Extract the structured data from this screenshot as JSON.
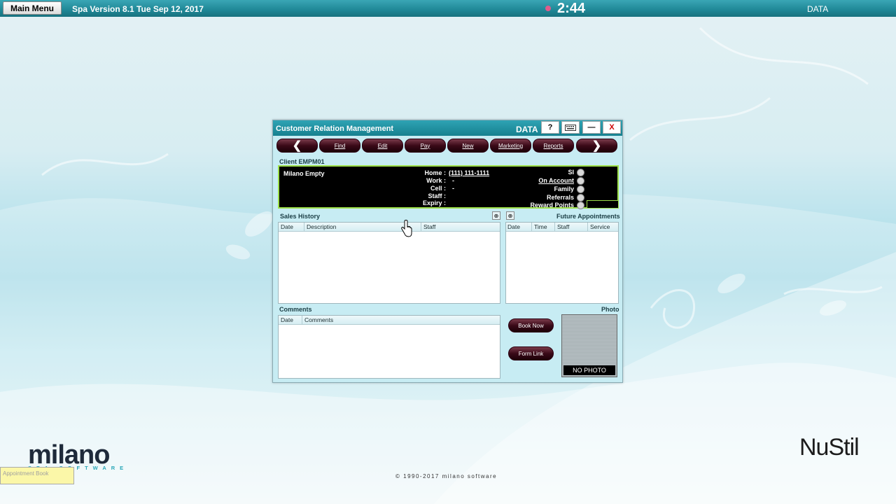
{
  "topbar": {
    "main_menu": "Main Menu",
    "version": "Spa Version 8.1   Tue Sep 12, 2017",
    "clock": "2:44",
    "data_label": "DATA"
  },
  "window": {
    "title": "Customer Relation Management",
    "data_label": "DATA",
    "help": "?",
    "minimize": "—",
    "close": "X",
    "toolbar": {
      "prev": "❮",
      "find": "Find",
      "edit": "Edit",
      "pay": "Pay",
      "new": "New",
      "marketing": "Marketing",
      "reports": "Reports",
      "next": "❯"
    },
    "client": {
      "label": "Client EMPM01",
      "name": "Milano Empty",
      "home_label": "Home :",
      "home_value": "(111) 111-1111",
      "work_label": "Work :",
      "work_value": "-",
      "cell_label": "Cell :",
      "cell_value": "-",
      "staff_label": "Staff :",
      "expiry_label": "Expiry :",
      "options": [
        "SI",
        "On Account",
        "Family",
        "Referrals",
        "Reward Points"
      ]
    },
    "sales_history": {
      "label": "Sales History",
      "columns": [
        "Date",
        "Description",
        "Staff"
      ]
    },
    "future_appointments": {
      "label": "Future Appointments",
      "columns": [
        "Date",
        "Time",
        "Staff",
        "Service"
      ]
    },
    "comments": {
      "label": "Comments",
      "columns": [
        "Date",
        "Comments"
      ]
    },
    "book_now": "Book Now",
    "form_link": "Form Link",
    "photo_label": "Photo",
    "no_photo": "NO PHOTO"
  },
  "footer": {
    "brand": "milano",
    "brand_sub": "SPA SOFTWARE",
    "appointment_book": "Appointment Book",
    "copyright": "© 1990-2017 milano software",
    "partner": "NuStil"
  }
}
